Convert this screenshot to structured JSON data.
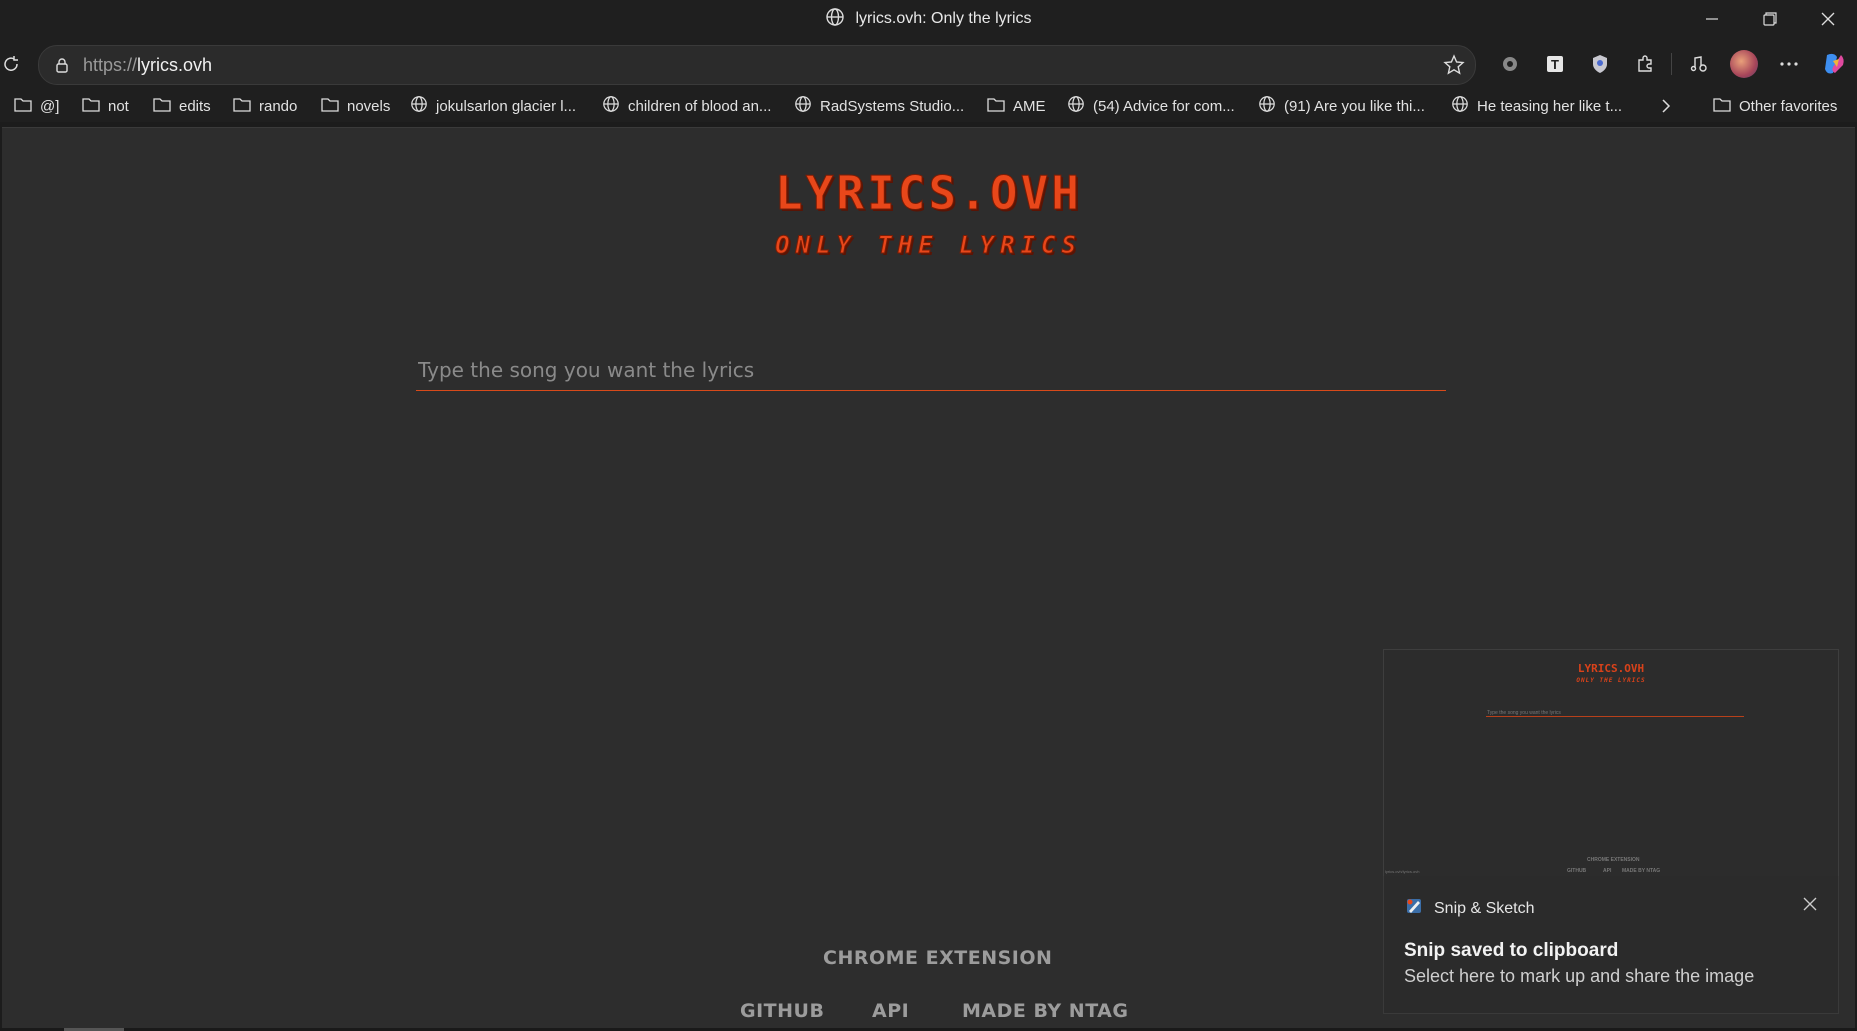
{
  "window": {
    "title": "lyrics.ovh: Only the lyrics"
  },
  "address_bar": {
    "protocol": "https://",
    "host": "lyrics.ovh"
  },
  "bookmarks": [
    {
      "label": "@]",
      "icon": "folder-icon"
    },
    {
      "label": "not",
      "icon": "folder-icon"
    },
    {
      "label": "edits",
      "icon": "folder-icon"
    },
    {
      "label": "rando",
      "icon": "folder-icon"
    },
    {
      "label": "novels",
      "icon": "folder-icon"
    },
    {
      "label": "jokulsarlon glacier l...",
      "icon": "globe-icon"
    },
    {
      "label": "children of blood an...",
      "icon": "globe-icon"
    },
    {
      "label": "RadSystems Studio...",
      "icon": "globe-icon"
    },
    {
      "label": "AME",
      "icon": "folder-icon"
    },
    {
      "label": "(54) Advice for com...",
      "icon": "globe-icon"
    },
    {
      "label": "(91) Are you like thi...",
      "icon": "globe-icon"
    },
    {
      "label": "He teasing her like t...",
      "icon": "globe-icon"
    }
  ],
  "other_favorites": "Other favorites",
  "page": {
    "logo": "LYRICS.OVH",
    "tagline": "ONLY THE LYRICS",
    "search_placeholder": "Type the song you want the lyrics",
    "footer": {
      "chrome_extension": "CHROME EXTENSION",
      "github": "GITHUB",
      "api": "API",
      "made_by": "MADE BY NTAG"
    }
  },
  "snip_preview": {
    "logo": "LYRICS.OVH",
    "tagline": "ONLY THE LYRICS",
    "search_placeholder": "Type the song you want the lyrics",
    "chrome_extension": "CHROME EXTENSION",
    "github": "GITHUB",
    "api": "API",
    "made_by": "MADE BY NTAG",
    "corner_text": "lyrics.ovh/lyrics.ovh"
  },
  "toast": {
    "app_name": "Snip & Sketch",
    "title": "Snip saved to clipboard",
    "body": "Select here to mark up and share the image"
  },
  "colors": {
    "accent": "#e8471a",
    "page_background": "#2d2d2d",
    "chrome_background": "#1f1f1f"
  }
}
